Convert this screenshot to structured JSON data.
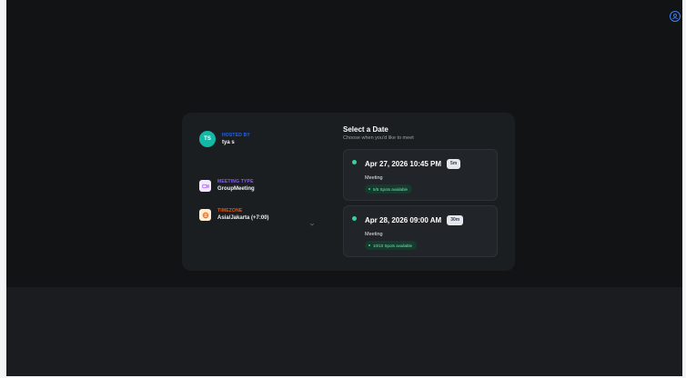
{
  "host": {
    "avatar_initials": "TS",
    "label": "HOSTED BY",
    "name": "tya s"
  },
  "meeting_type": {
    "label": "MEETING TYPE",
    "value": "GroupMeeting",
    "icon": "video-icon"
  },
  "timezone": {
    "label": "TIMEZONE",
    "value": "Asia/Jakarta (+7:00)",
    "icon": "globe-icon"
  },
  "date_picker": {
    "title": "Select a Date",
    "subtitle": "Choose when you'd like to meet",
    "slots": [
      {
        "datetime": "Apr 27, 2026 10:45 PM",
        "duration": "5m",
        "type": "Meeting",
        "availability": "5/5 Spots available"
      },
      {
        "datetime": "Apr 28, 2026 09:00 AM",
        "duration": "30m",
        "type": "Meeting",
        "availability": "10/10 Spots available"
      }
    ]
  },
  "colors": {
    "background": "#111315",
    "card": "#1b1e21",
    "accent_blue": "#2563eb",
    "accent_purple": "#8b5cf6",
    "accent_orange": "#ea580c",
    "available_green": "#34d399"
  }
}
